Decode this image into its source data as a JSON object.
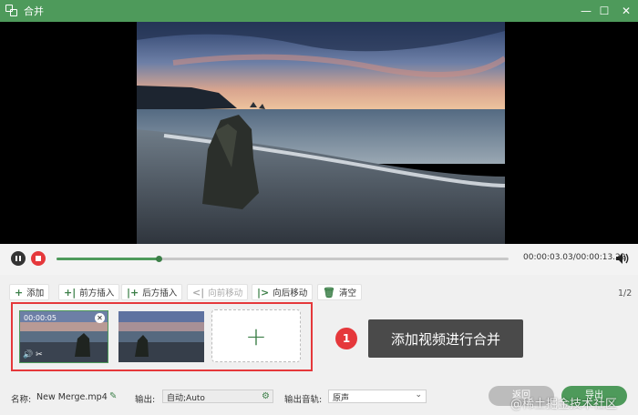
{
  "window": {
    "title": "合并"
  },
  "playback": {
    "timecode": "00:00:03.03/00:00:13.22",
    "progress_fraction": 0.225
  },
  "toolbar": {
    "add": "添加",
    "insert_before": "前方插入",
    "insert_after": "后方插入",
    "move_forward": "向前移动",
    "move_backward": "向后移动",
    "clear": "清空",
    "page_count": "1/2"
  },
  "clips": [
    {
      "duration": "00:00:05"
    }
  ],
  "annotation": {
    "number": "1",
    "text": "添加视频进行合并"
  },
  "settings": {
    "name_label": "名称:",
    "name_value": "New Merge.mp4",
    "output_label": "输出:",
    "output_value": "自动;Auto",
    "audio_label": "输出音轨:",
    "audio_value": "原声",
    "return_label": "返回",
    "export_label": "导出"
  },
  "watermark": "@稀土掘金技术社区",
  "colors": {
    "accent": "#4e9a5b",
    "highlight": "#e5383b"
  }
}
